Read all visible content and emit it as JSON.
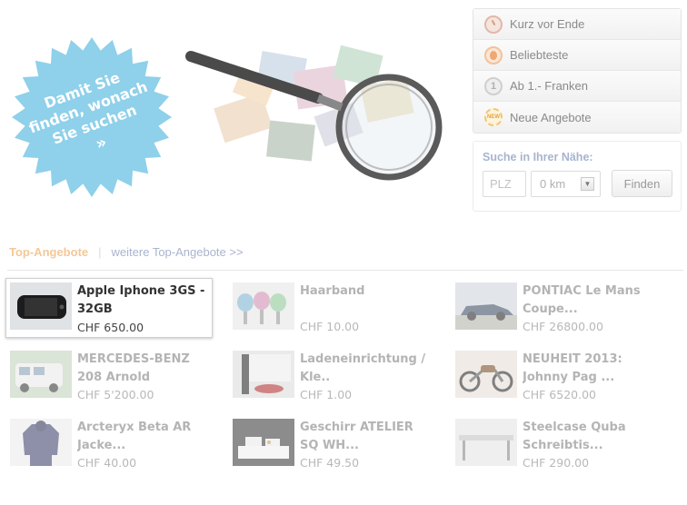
{
  "hero": {
    "badge_lines": [
      "Damit Sie",
      "finden, wonach",
      "Sie suchen"
    ],
    "badge_chevron": "»",
    "badge_color": "#8fd0ea"
  },
  "quick_links": [
    {
      "label": "Kurz vor Ende",
      "icon": "clock-icon"
    },
    {
      "label": "Beliebteste",
      "icon": "flame-icon"
    },
    {
      "label": "Ab 1.- Franken",
      "icon": "one-franc-icon"
    },
    {
      "label": "Neue Angebote",
      "icon": "new-badge-icon",
      "icon_text": "NEW"
    }
  ],
  "nearby": {
    "title": "Suche in Ihrer Nähe:",
    "zip_placeholder": "PLZ",
    "radius_value": "0 km",
    "find_label": "Finden"
  },
  "top_offers": {
    "title": "Top-Angebote",
    "separator": "|",
    "more_link": "weitere Top-Angebote >>"
  },
  "listings": [
    {
      "title": "Apple Iphone 3GS - 32GB",
      "price": "CHF 650.00",
      "thumb": "phone"
    },
    {
      "title": "Haarband",
      "price": "CHF 10.00",
      "thumb": "hairband"
    },
    {
      "title": "PONTIAC Le Mans Coupe...",
      "price": "CHF 26800.00",
      "thumb": "car"
    },
    {
      "title": "MERCEDES-BENZ 208 Arnold",
      "price": "CHF 5'200.00",
      "thumb": "van"
    },
    {
      "title": "Ladeneinrichtung / Kle..",
      "price": "CHF 1.00",
      "thumb": "shop"
    },
    {
      "title": "NEUHEIT 2013: Johnny Pag ...",
      "price": "CHF 6520.00",
      "thumb": "motorcycle"
    },
    {
      "title": "Arcteryx Beta AR Jacke...",
      "price": "CHF 40.00",
      "thumb": "jacket"
    },
    {
      "title": "Geschirr ATELIER SQ WH...",
      "price": "CHF 49.50",
      "thumb": "dishes"
    },
    {
      "title": "Steelcase Quba Schreibtis...",
      "price": "CHF 290.00",
      "thumb": "desk"
    }
  ],
  "colors": {
    "accent_orange": "#f4c898",
    "link_blue": "#a9b4cf",
    "badge_blue": "#8fd0ea"
  }
}
